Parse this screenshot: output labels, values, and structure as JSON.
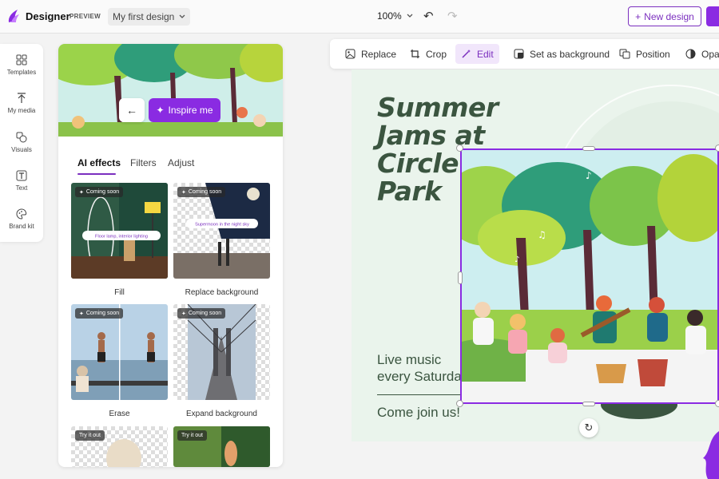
{
  "app": {
    "name": "Designer",
    "preview_tag": "PREVIEW",
    "design_name": "My first design"
  },
  "topbar": {
    "zoom": "100%",
    "new_design_label": "New design"
  },
  "rail": [
    {
      "label": "Templates",
      "icon": "templates-icon"
    },
    {
      "label": "My media",
      "icon": "upload-icon"
    },
    {
      "label": "Visuals",
      "icon": "shapes-icon"
    },
    {
      "label": "Text",
      "icon": "text-icon"
    },
    {
      "label": "Brand kit",
      "icon": "palette-icon"
    }
  ],
  "panel": {
    "inspire_label": "Inspire me",
    "tabs": [
      "AI effects",
      "Filters",
      "Adjust"
    ],
    "active_tab": "AI effects",
    "cards": [
      {
        "label": "Fill",
        "badge": "Coming soon",
        "overlay_text": "Floor lamp, interior lighting"
      },
      {
        "label": "Replace background",
        "badge": "Coming soon",
        "overlay_text": "Supermoon in the night sky"
      },
      {
        "label": "Erase",
        "badge": "Coming soon"
      },
      {
        "label": "Expand background",
        "badge": "Coming soon"
      },
      {
        "badge": "Try it out"
      },
      {
        "badge": "Try it out"
      }
    ]
  },
  "toolbar": {
    "items": [
      "Replace",
      "Crop",
      "Edit",
      "Set as background",
      "Position",
      "Opacity"
    ],
    "active": "Edit"
  },
  "canvas": {
    "headline": [
      "Summer",
      "Jams at",
      "Circle",
      "Park"
    ],
    "body_lines": [
      "Live music",
      "every Saturday"
    ],
    "cta": "Come join us!"
  },
  "colors": {
    "accent": "#8a2be2",
    "text_green": "#3b5540",
    "canvas_bg": "#eaf4ec"
  }
}
